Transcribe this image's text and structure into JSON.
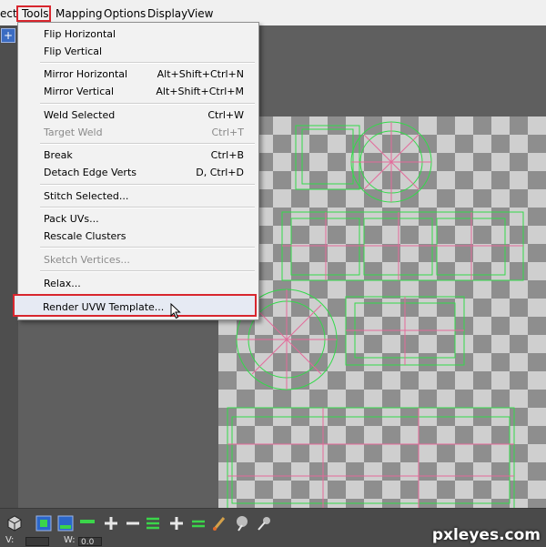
{
  "menubar": {
    "items": [
      {
        "label": "ect"
      },
      {
        "label": "Tools"
      },
      {
        "label": "Mapping"
      },
      {
        "label": "Options"
      },
      {
        "label": "Display"
      },
      {
        "label": "View"
      }
    ]
  },
  "toolbar_corner_icon": "plus-icon",
  "tools_menu": {
    "items": [
      {
        "label": "Flip Horizontal",
        "shortcut": ""
      },
      {
        "label": "Flip Vertical",
        "shortcut": ""
      },
      {
        "label": "Mirror Horizontal",
        "shortcut": "Alt+Shift+Ctrl+N"
      },
      {
        "label": "Mirror Vertical",
        "shortcut": "Alt+Shift+Ctrl+M"
      },
      {
        "label": "Weld Selected",
        "shortcut": "Ctrl+W"
      },
      {
        "label": "Target Weld",
        "shortcut": "Ctrl+T",
        "disabled": true
      },
      {
        "label": "Break",
        "shortcut": "Ctrl+B"
      },
      {
        "label": "Detach Edge Verts",
        "shortcut": "D, Ctrl+D"
      },
      {
        "label": "Stitch Selected...",
        "shortcut": ""
      },
      {
        "label": "Pack UVs...",
        "shortcut": ""
      },
      {
        "label": "Rescale Clusters",
        "shortcut": ""
      },
      {
        "label": "Sketch Vertices...",
        "shortcut": "",
        "disabled": true
      },
      {
        "label": "Relax...",
        "shortcut": ""
      },
      {
        "label": "Render UVW Template...",
        "shortcut": "",
        "highlighted": true
      }
    ]
  },
  "status": {
    "v_label": "V:",
    "w_label": "W:",
    "w_value": "0.0"
  },
  "watermark": "pxleyes.com",
  "colors": {
    "uv_edge": "#33d94a",
    "uv_seam": "#e46a9a",
    "highlight_box": "#d8262e",
    "checker_light": "#cfcfcf",
    "checker_dark": "#8e8e8e"
  }
}
